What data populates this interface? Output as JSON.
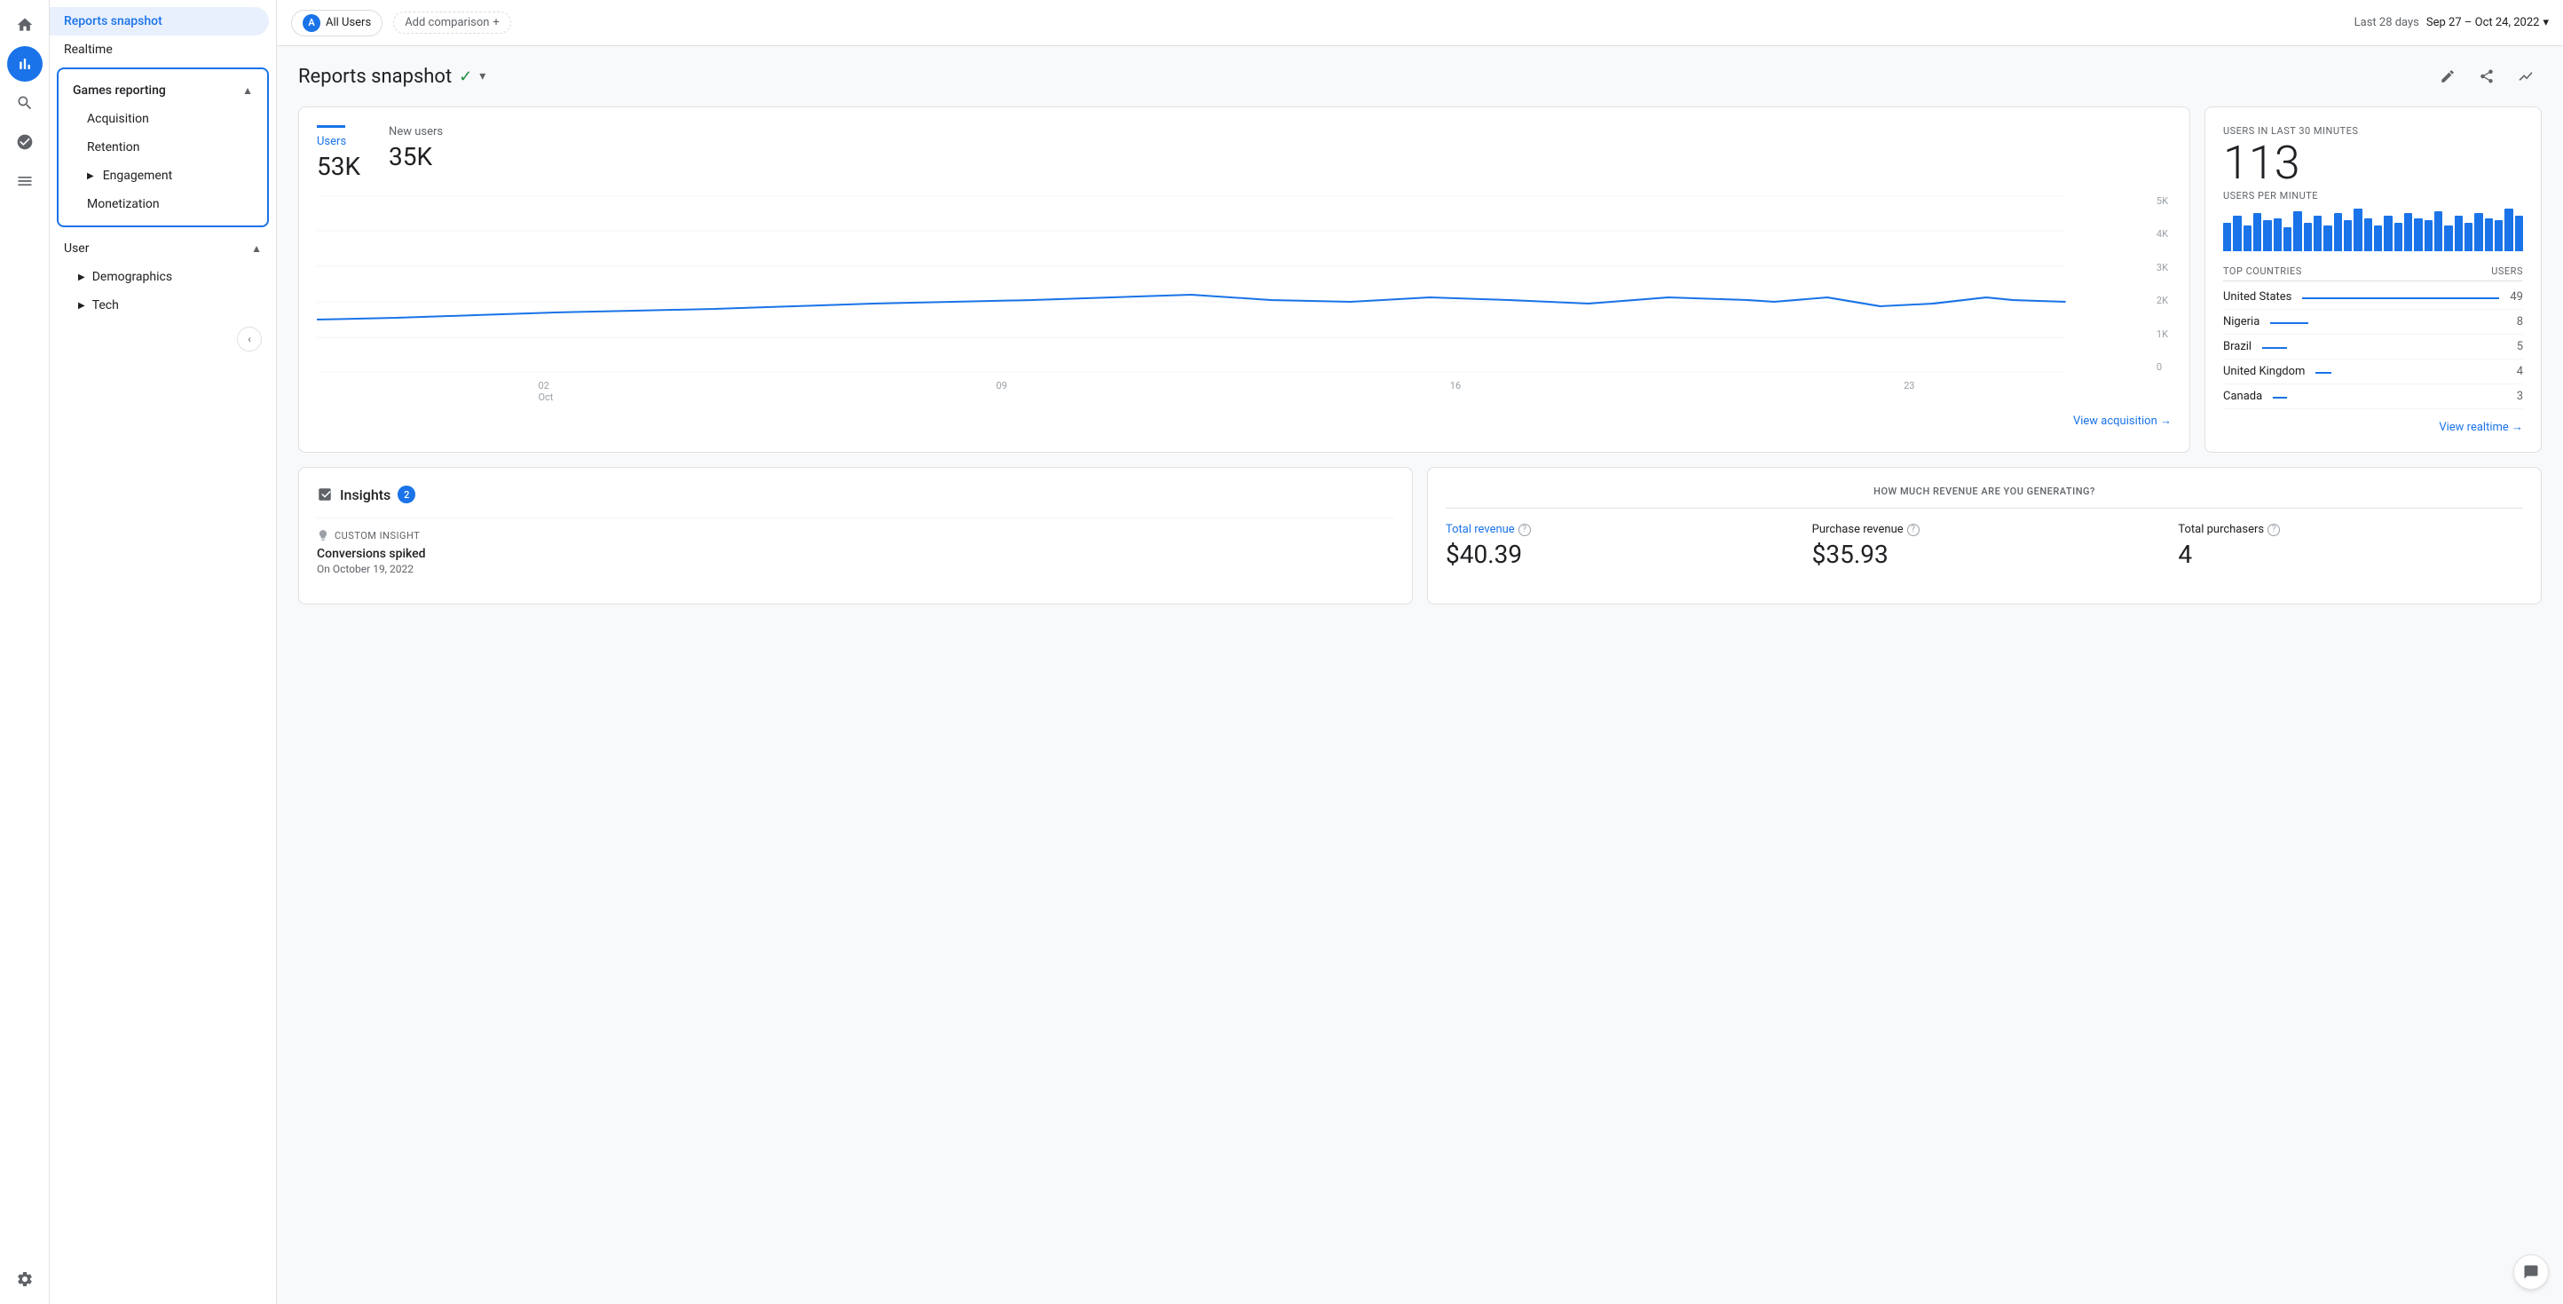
{
  "iconBar": {
    "items": [
      {
        "name": "home-icon",
        "icon": "⌂",
        "active": false
      },
      {
        "name": "analytics-icon",
        "icon": "📊",
        "active": true
      },
      {
        "name": "search-icon",
        "icon": "🔍",
        "active": false
      },
      {
        "name": "audience-icon",
        "icon": "👥",
        "active": false
      },
      {
        "name": "reports-icon",
        "icon": "☰",
        "active": false
      }
    ],
    "bottomItems": [
      {
        "name": "settings-icon",
        "icon": "⚙"
      }
    ]
  },
  "sidebar": {
    "topItem": "Reports snapshot",
    "realtimeItem": "Realtime",
    "gamesReporting": {
      "label": "Games reporting",
      "items": [
        "Acquisition",
        "Retention",
        "Engagement",
        "Monetization"
      ]
    },
    "userSection": {
      "label": "User",
      "items": [
        "Demographics",
        "Tech"
      ]
    }
  },
  "topBar": {
    "userChip": "All Users",
    "addComparison": "Add comparison",
    "lastDays": "Last 28 days",
    "dateRange": "Sep 27 – Oct 24, 2022"
  },
  "contentTitle": "Reports snapshot",
  "titleIcon": "✓",
  "stats": {
    "users": {
      "label": "Users",
      "value": "53K"
    },
    "newUsers": {
      "label": "New users",
      "value": "35K"
    }
  },
  "chartXLabels": [
    "02 Oct",
    "09",
    "16",
    "23"
  ],
  "chartYLabels": [
    "5K",
    "4K",
    "3K",
    "2K",
    "1K",
    "0"
  ],
  "viewAcquisition": "View acquisition →",
  "realtime": {
    "label": "USERS IN LAST 30 MINUTES",
    "value": "113",
    "perMinLabel": "USERS PER MINUTE",
    "barHeights": [
      60,
      75,
      55,
      80,
      65,
      70,
      50,
      85,
      60,
      75,
      55,
      80,
      65,
      90,
      70,
      55,
      75,
      60,
      80,
      70,
      65,
      85,
      55,
      75,
      60,
      80,
      70,
      65,
      90,
      75
    ],
    "topCountriesLabel": "TOP COUNTRIES",
    "usersLabel": "USERS",
    "countries": [
      {
        "name": "United States",
        "count": 49,
        "barWidth": 100
      },
      {
        "name": "Nigeria",
        "count": 8,
        "barWidth": 16
      },
      {
        "name": "Brazil",
        "count": 5,
        "barWidth": 10
      },
      {
        "name": "United Kingdom",
        "count": 4,
        "barWidth": 8
      },
      {
        "name": "Canada",
        "count": 3,
        "barWidth": 6
      }
    ],
    "viewRealtime": "View realtime →"
  },
  "revenue": {
    "sectionLabel": "HOW MUCH REVENUE ARE YOU GENERATING?",
    "totalRevenue": {
      "label": "Total revenue",
      "value": "$40.39"
    },
    "purchaseRevenue": {
      "label": "Purchase revenue",
      "value": "$35.93"
    },
    "totalPurchasers": {
      "label": "Total purchasers",
      "value": "4"
    }
  },
  "insights": {
    "label": "Insights",
    "badge": "2",
    "items": [
      {
        "type": "CUSTOM INSIGHT",
        "title": "Conversions spiked",
        "date": "On October 19, 2022"
      }
    ]
  },
  "toolbar": {
    "editIcon": "✏",
    "shareIcon": "↗",
    "moreIcon": "⌇"
  }
}
